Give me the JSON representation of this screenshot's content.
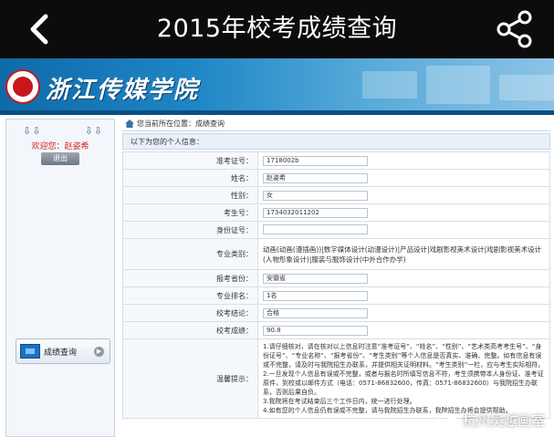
{
  "appbar": {
    "title": "2015年校考成绩查询"
  },
  "banner": {
    "school_name": "浙江传媒学院"
  },
  "sidebar": {
    "arrows_left": "⇩⇩",
    "arrows_right": "⇩⇩",
    "user": "欢迎您：赵姿希",
    "logout_label": "退出",
    "menu_item": "成绩查询"
  },
  "main": {
    "breadcrumb": "您当前所在位置：成绩查询",
    "section_title": "以下为您的个人信息：",
    "rows": [
      {
        "label": "准考证号：",
        "value": "1718002b"
      },
      {
        "label": "姓名：",
        "value": "赵姿希"
      },
      {
        "label": "性别：",
        "value": "女"
      },
      {
        "label": "考生号：",
        "value": "1734032011202"
      },
      {
        "label": "身份证号：",
        "value": ""
      },
      {
        "label": "专业类别：",
        "value": "动画(动画(漫插画))|数字媒体设计(动漫设计)|产品设计|戏剧影视美术设计|戏剧影视美术设计(人物形象设计)|服装与服饰设计(中外合作办学)"
      },
      {
        "label": "报考省份：",
        "value": "安徽省"
      },
      {
        "label": "专业排名：",
        "value": "1名"
      },
      {
        "label": "校考结论：",
        "value": "合格"
      },
      {
        "label": "校考成绩：",
        "value": "90.8"
      }
    ],
    "notice_label": "温馨提示：",
    "notice_lines": [
      "1.请仔细核对，请在核对以上信息时注意“准考证号”、“姓名”、“性别”、“艺术类高考考生号”、“身份证号”、“专业名称”、“报考省份”、“考生类别”等个人信息是否真实、准确、完整。如有信息有误或不完整，请及时与我院招生办联系，并提供相关证明材料。“考生类别”一栏，应与考生实际相符。",
      "2.一旦发现个人信息有误或不完整，或者与报名时所填写信息不符，考生须携带本人身份证、准考证原件，到校或以邮件方式（电话：0571-86832600，传真：0571-86832600）与我院招生办联系，否则后果自负。",
      "3.我院将在考试结束后三个工作日内，统一进行处理。",
      "4.如有您的个人信息仍有误或不完整，请与我院招生办联系，我院招生办将会提供帮助。"
    ]
  },
  "watermark": "杭州吴越画室"
}
